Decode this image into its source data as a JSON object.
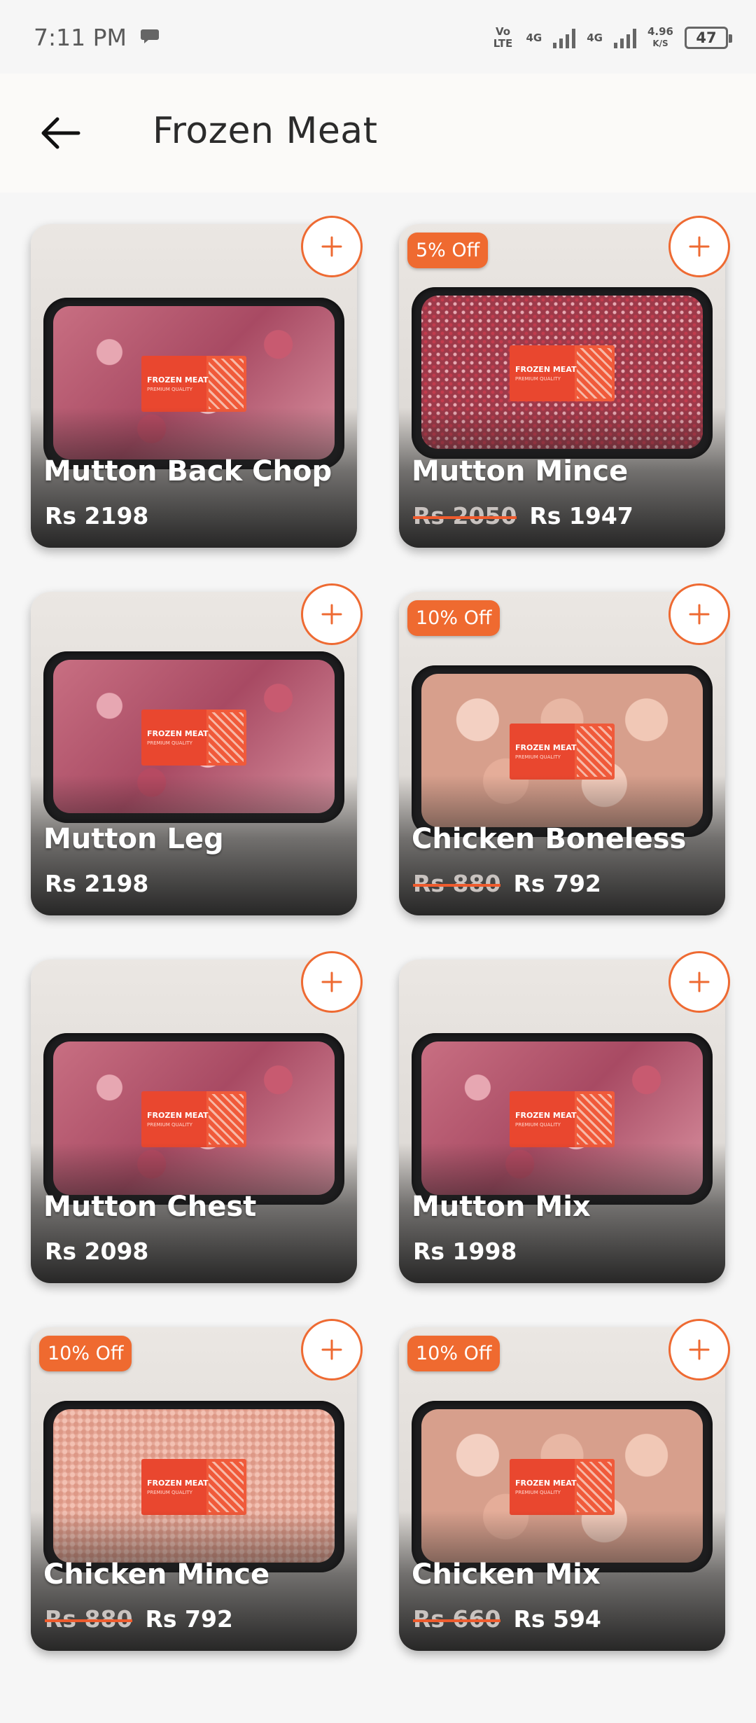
{
  "status_bar": {
    "time": "7:11 PM",
    "net1": "Vo LTE",
    "net2": "4G",
    "net3": "4G",
    "speed": "4.96",
    "speed_unit": "K/S",
    "battery": "47"
  },
  "app_bar": {
    "title": "Frozen Meat"
  },
  "colors": {
    "accent": "#ee6a32"
  },
  "products": [
    {
      "name": "Mutton Back Chop",
      "price": "Rs 2198",
      "old_price": "",
      "discount": "",
      "meat": "red"
    },
    {
      "name": "Mutton Mince",
      "price": "Rs 1947",
      "old_price": "Rs 2050",
      "discount": "5% Off",
      "meat": "mince"
    },
    {
      "name": "Mutton Leg",
      "price": "Rs 2198",
      "old_price": "",
      "discount": "",
      "meat": "red"
    },
    {
      "name": "Chicken Boneless",
      "price": "Rs 792",
      "old_price": "Rs 880",
      "discount": "10% Off",
      "meat": "chicken"
    },
    {
      "name": "Mutton Chest",
      "price": "Rs 2098",
      "old_price": "",
      "discount": "",
      "meat": "red"
    },
    {
      "name": "Mutton Mix",
      "price": "Rs 1998",
      "old_price": "",
      "discount": "",
      "meat": "red"
    },
    {
      "name": "Chicken Mince",
      "price": "Rs 792",
      "old_price": "Rs 880",
      "discount": "10% Off",
      "meat": "cmince"
    },
    {
      "name": "Chicken Mix",
      "price": "Rs 594",
      "old_price": "Rs 660",
      "discount": "10% Off",
      "meat": "chicken"
    }
  ]
}
